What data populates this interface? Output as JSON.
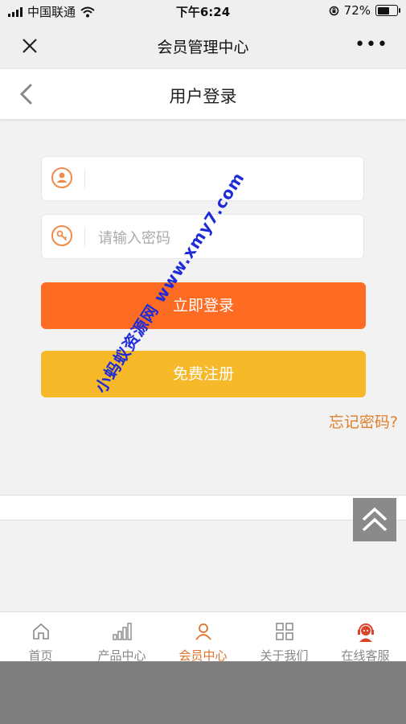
{
  "status_bar": {
    "carrier": "中国联通",
    "time": "下午6:24",
    "battery_text": "72%",
    "battery_level": 0.72
  },
  "wechat_nav": {
    "title": "会员管理中心",
    "more_label": "•••"
  },
  "page_header": {
    "title": "用户登录"
  },
  "login_form": {
    "username_value": "",
    "username_placeholder": "",
    "password_placeholder": "请输入密码",
    "login_label": "立即登录",
    "register_label": "免费注册",
    "forgot_label": "忘记密码?"
  },
  "watermark": {
    "text": "小蚂蚁资源网 www.xmy7.com"
  },
  "tab_bar": {
    "items": [
      {
        "label": "首页",
        "icon": "home-icon"
      },
      {
        "label": "产品中心",
        "icon": "bar-chart-icon"
      },
      {
        "label": "会员中心",
        "icon": "user-icon"
      },
      {
        "label": "关于我们",
        "icon": "grid-icon"
      },
      {
        "label": "在线客服",
        "icon": "support-icon"
      }
    ],
    "active_index": 2
  },
  "colors": {
    "accent_orange": "#fe6c23",
    "register_yellow": "#f5b929",
    "link_orange": "#e0802a",
    "icon_orange": "#f08a4a",
    "watermark_blue": "#1d2bd8"
  }
}
